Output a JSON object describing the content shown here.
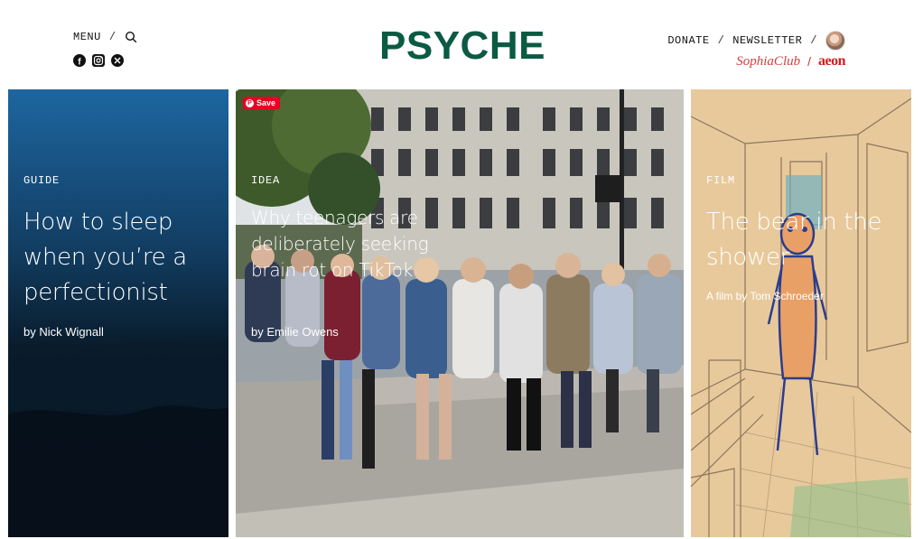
{
  "header": {
    "menu_label": "MENU",
    "separator": "/",
    "logo": "PSYCHE",
    "right_links": [
      "DONATE",
      "NEWSLETTER"
    ],
    "partners": {
      "sophia": "SophiaClub",
      "aeon": "aeon"
    },
    "social_icons": [
      "facebook-icon",
      "instagram-icon",
      "x-icon"
    ],
    "brand_color": "#0b5a43",
    "accent_color": "#d11f1f"
  },
  "cards": [
    {
      "kicker": "GUIDE",
      "title": "How to sleep when you’re a perfectionist",
      "byline": "by Nick Wignall"
    },
    {
      "kicker": "IDEA",
      "title": "Why teenagers are deliberately seeking brain rot on TikTok",
      "byline": "by Emilie Owens",
      "save_label": "Save"
    },
    {
      "kicker": "FILM",
      "title": "The bear in the shower",
      "byline": "A film by Tom Schroeder"
    }
  ]
}
